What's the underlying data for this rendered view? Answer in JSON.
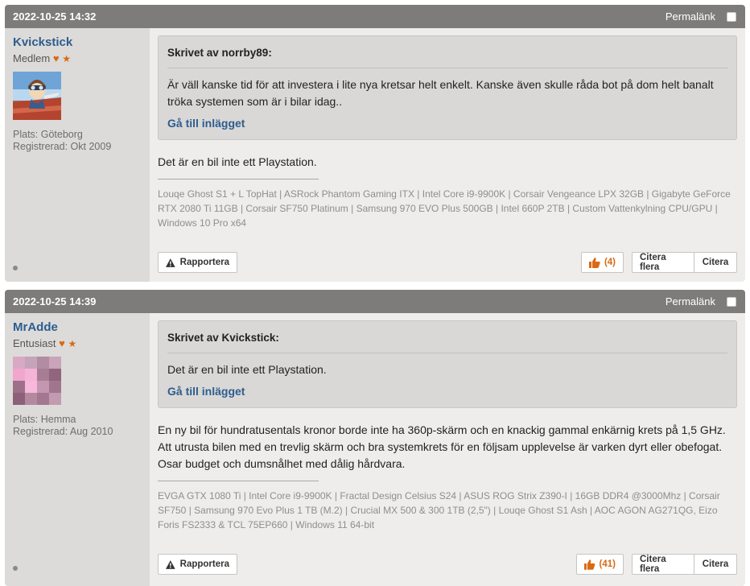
{
  "posts": [
    {
      "date": "2022-10-25 14:32",
      "permalink": "Permalänk",
      "user": {
        "name": "Kvickstick",
        "rank": "Medlem",
        "heart": "♥",
        "star": "★",
        "location": "Plats: Göteborg",
        "registered": "Registrerad: Okt 2009",
        "avatar": "cartoon-pilot-avatar"
      },
      "quote": {
        "author": "Skrivet av norrby89:",
        "text": "Är väll kanske tid för att investera i lite nya kretsar helt enkelt. Kanske även skulle råda bot på dom helt banalt tröka systemen som är i bilar idag..",
        "link": "Gå till inlägget"
      },
      "message": "Det är en bil inte ett Playstation.",
      "signature": "Louqe Ghost S1 + L TopHat | ASRock Phantom Gaming ITX | Intel Core i9-9900K | Corsair Vengeance LPX 32GB | Gigabyte GeForce RTX 2080 Ti 11GB | Corsair SF750 Platinum | Samsung 970 EVO Plus 500GB | Intel 660P 2TB | Custom Vattenkylning CPU/GPU | Windows 10 Pro x64",
      "report_label": "Rapportera",
      "likes": "(4)",
      "cite_multi": "Citera flera",
      "cite": "Citera"
    },
    {
      "date": "2022-10-25 14:39",
      "permalink": "Permalänk",
      "user": {
        "name": "MrAdde",
        "rank": "Entusiast",
        "heart": "♥",
        "star": "★",
        "location": "Plats: Hemma",
        "registered": "Registrerad: Aug 2010",
        "avatar": "pink-pixel-avatar"
      },
      "quote": {
        "author": "Skrivet av Kvickstick:",
        "text": "Det är en bil inte ett Playstation.",
        "link": "Gå till inlägget"
      },
      "message": "En ny bil för hundratusentals kronor borde inte ha 360p-skärm och en knackig gammal enkärnig krets på 1,5 GHz. Att utrusta bilen med en trevlig skärm och bra systemkrets för en följsam upplevelse är varken dyrt eller obefogat. Osar budget och dumsnålhet med dålig hårdvara.",
      "signature": "EVGA GTX 1080 Ti | Intel Core i9-9900K | Fractal Design Celsius S24 | ASUS ROG Strix Z390-I | 16GB DDR4 @3000Mhz | Corsair SF750 | Samsung 970 Evo Plus 1 TB (M.2) | Crucial MX 500 & 300 1TB (2,5\") | Louqe Ghost S1 Ash | AOC AGON AG271QG, Eizo Foris FS2333 & TCL 75EP660 | Windows 11 64-bit",
      "report_label": "Rapportera",
      "likes": "(41)",
      "cite_multi": "Citera flera",
      "cite": "Citera"
    }
  ],
  "colors": {
    "header": "#7d7c7a",
    "username": "#2d5d8f",
    "accent": "#d96914"
  }
}
